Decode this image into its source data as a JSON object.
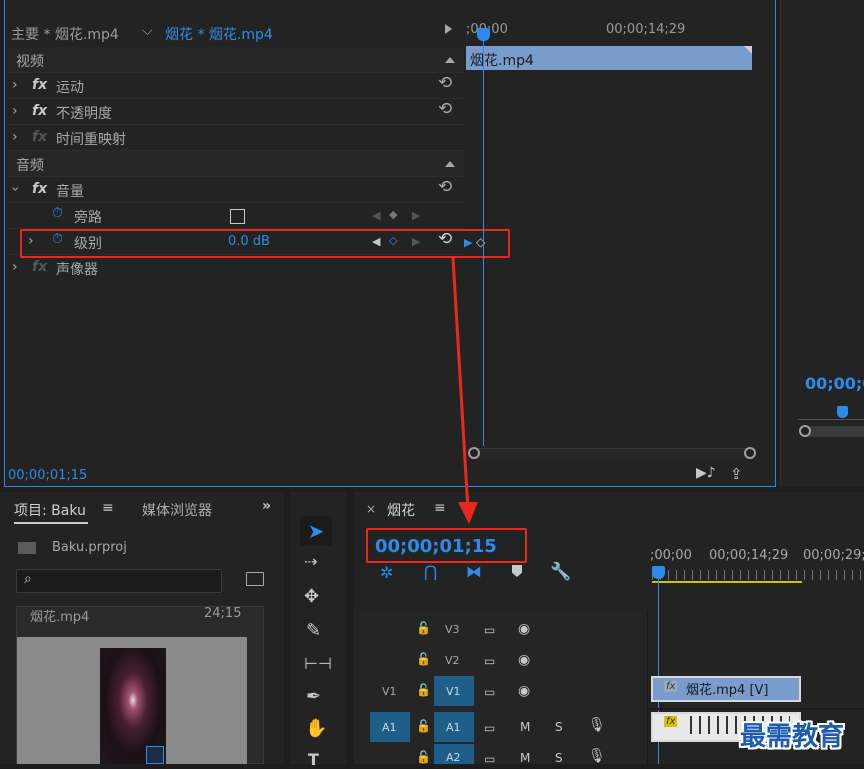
{
  "effects": {
    "tab_master": "主要 * 烟花.mp4",
    "tab_clip": "烟花 * 烟花.mp4",
    "ruler_left": ";00;00",
    "ruler_right": "00;00;14;29",
    "clip_label": "烟花.mp4",
    "sections": {
      "video": "视频",
      "audio": "音频"
    },
    "items": {
      "motion": "运动",
      "opacity": "不透明度",
      "time_remap": "时间重映射",
      "volume": "音量",
      "bypass": "旁路",
      "level": "级别",
      "level_value": "0.0 dB",
      "panner": "声像器"
    },
    "fx": "fx",
    "timecode": "00;00;01;15"
  },
  "monitor": {
    "timecode": "00;00;0"
  },
  "project": {
    "tab_project": "项目: Baku",
    "tab_media": "媒体浏览器",
    "file": "Baku.prproj",
    "clip_name": "烟花.mp4",
    "clip_duration": "24;15"
  },
  "timeline": {
    "tab": "烟花",
    "timecode": "00;00;01;15",
    "ruler": [
      ";00;00",
      "00;00;14;29",
      "00;00;29;2"
    ],
    "tracks": {
      "v3": "V3",
      "v2": "V2",
      "v1_src": "V1",
      "v1": "V1",
      "a1_src": "A1",
      "a1": "A1",
      "a2": "A2",
      "m": "M",
      "s": "S"
    },
    "clip_v1": "烟花.mp4 [V]",
    "fx": "fx"
  },
  "watermark": "最需教育"
}
